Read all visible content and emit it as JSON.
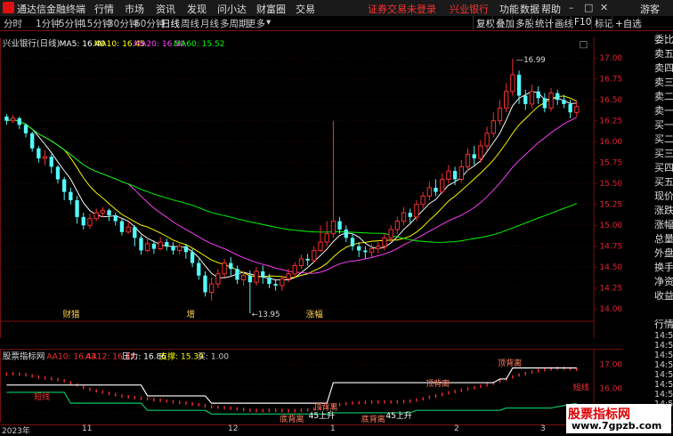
{
  "app": {
    "title": "通达信金融终端",
    "menu": [
      "行情",
      "市场",
      "资讯",
      "发现",
      "问小达",
      "财富圈",
      "交易"
    ],
    "login_notice": "证券交易未登录",
    "stock_name_title": "兴业银行",
    "right_menu": [
      "功能",
      "数据",
      "帮助"
    ],
    "user": "游客"
  },
  "toolbar": {
    "periods": [
      "分时",
      "1分钟",
      "5分钟",
      "15分钟",
      "30分钟",
      "60分钟",
      "日线",
      "周线",
      "月线",
      "多周期",
      "更多"
    ],
    "active_period": "日线",
    "right_buttons": [
      "复权",
      "叠加",
      "多股",
      "统计",
      "画线",
      "F10",
      "标记",
      "+自选"
    ]
  },
  "main_chart": {
    "label": "兴业银行(日线)",
    "ma_labels": [
      {
        "text": "MA5: 16.40",
        "color": "#ffffff"
      },
      {
        "text": "MA10: 16.45",
        "color": "#ffff00"
      },
      {
        "text": "MA20: 16.50",
        "color": "#ff40ff"
      },
      {
        "text": "MA60: 15.52",
        "color": "#00ff00"
      }
    ],
    "high_annot": "16.99",
    "low_annot": "←13.95",
    "markers": [
      "财猎",
      "增",
      "涨幅"
    ]
  },
  "indicator": {
    "name": "股票指标网",
    "values": [
      {
        "text": "AA10: 16.43",
        "color": "#ff3030"
      },
      {
        "text": "AA12: 16.48",
        "color": "#ff3030"
      },
      {
        "text": "压力: 16.86",
        "color": "#ffffff"
      },
      {
        "text": "支撑: 15.39",
        "color": "#ffff00"
      },
      {
        "text": "买: 1.00",
        "color": "#cccccc"
      }
    ],
    "annotations": [
      "顶背离",
      "顶背离",
      "顶背离",
      "短线",
      "短线",
      "45上升",
      "45上升",
      "底背离",
      "底背离"
    ]
  },
  "side_panel": {
    "labels": [
      "委比",
      "卖五",
      "卖四",
      "卖三",
      "卖二",
      "卖一",
      "买一",
      "买二",
      "买三",
      "买四",
      "买五",
      "现价",
      "涨跌",
      "涨幅",
      "总量",
      "外盘",
      "换手",
      "净资",
      "收益",
      "",
      "行情"
    ],
    "times": [
      "14:50",
      "14:50",
      "14:50",
      "14:50",
      "14:50",
      "14:50",
      "14:50",
      "14:50"
    ]
  },
  "bottom": {
    "dates": [
      "2023年",
      "11",
      "12",
      "1",
      "2",
      "3"
    ]
  },
  "watermark": {
    "line1": "股票指标网",
    "line2": "www.7gpzb.com"
  },
  "chart_data": [
    {
      "type": "candlestick",
      "title": "兴业银行(日线)",
      "y_ticks": [
        14.0,
        14.25,
        14.5,
        14.75,
        15.0,
        15.25,
        15.5,
        15.75,
        16.0,
        16.25,
        16.5,
        16.75,
        17.0
      ],
      "ylim": [
        13.9,
        17.1
      ],
      "annotations": [
        {
          "text": "16.99",
          "value": 16.99
        },
        {
          "text": "←13.95",
          "value": 13.95
        }
      ],
      "candles": [
        [
          16.3,
          16.25,
          16.33,
          16.2
        ],
        [
          16.25,
          16.28,
          16.32,
          16.22
        ],
        [
          16.28,
          16.2,
          16.3,
          16.15
        ],
        [
          16.2,
          16.1,
          16.22,
          16.05
        ],
        [
          16.1,
          15.92,
          16.12,
          15.88
        ],
        [
          15.92,
          15.8,
          15.95,
          15.75
        ],
        [
          15.8,
          15.82,
          15.9,
          15.72
        ],
        [
          15.82,
          15.7,
          15.85,
          15.62
        ],
        [
          15.7,
          15.55,
          15.72,
          15.5
        ],
        [
          15.55,
          15.4,
          15.58,
          15.3
        ],
        [
          15.4,
          15.3,
          15.45,
          15.25
        ],
        [
          15.3,
          15.1,
          15.35,
          15.02
        ],
        [
          15.1,
          15.0,
          15.15,
          14.95
        ],
        [
          15.0,
          15.08,
          15.14,
          14.96
        ],
        [
          15.08,
          15.15,
          15.2,
          15.05
        ],
        [
          15.15,
          15.18,
          15.22,
          15.1
        ],
        [
          15.18,
          15.12,
          15.2,
          15.05
        ],
        [
          15.12,
          15.05,
          15.15,
          15.0
        ],
        [
          15.05,
          14.92,
          15.08,
          14.88
        ],
        [
          14.92,
          14.98,
          15.05,
          14.9
        ],
        [
          14.98,
          14.85,
          15.0,
          14.75
        ],
        [
          14.85,
          14.7,
          14.88,
          14.65
        ],
        [
          14.7,
          14.78,
          14.85,
          14.68
        ],
        [
          14.78,
          14.72,
          14.82,
          14.66
        ],
        [
          14.72,
          14.8,
          14.86,
          14.7
        ],
        [
          14.8,
          14.75,
          14.84,
          14.7
        ],
        [
          14.75,
          14.7,
          14.8,
          14.65
        ],
        [
          14.7,
          14.75,
          14.8,
          14.65
        ],
        [
          14.75,
          14.68,
          14.78,
          14.6
        ],
        [
          14.68,
          14.55,
          14.72,
          14.5
        ],
        [
          14.55,
          14.4,
          14.6,
          14.35
        ],
        [
          14.4,
          14.2,
          14.45,
          14.15
        ],
        [
          14.2,
          14.3,
          14.38,
          14.1
        ],
        [
          14.3,
          14.42,
          14.48,
          14.25
        ],
        [
          14.42,
          14.55,
          14.6,
          14.38
        ],
        [
          14.55,
          14.48,
          14.62,
          14.4
        ],
        [
          14.48,
          14.35,
          14.52,
          14.3
        ],
        [
          14.35,
          14.4,
          14.45,
          14.28
        ],
        [
          14.4,
          14.32,
          14.46,
          13.95
        ],
        [
          14.32,
          14.45,
          14.5,
          14.28
        ],
        [
          14.45,
          14.38,
          14.52,
          14.3
        ],
        [
          14.38,
          14.3,
          14.42,
          14.25
        ],
        [
          14.3,
          14.28,
          14.36,
          14.22
        ],
        [
          14.28,
          14.36,
          14.4,
          14.22
        ],
        [
          14.36,
          14.42,
          14.48,
          14.32
        ],
        [
          14.42,
          14.52,
          14.56,
          14.38
        ],
        [
          14.52,
          14.6,
          14.65,
          14.48
        ],
        [
          14.6,
          14.58,
          14.66,
          14.52
        ],
        [
          14.58,
          14.7,
          14.75,
          14.55
        ],
        [
          14.7,
          14.8,
          15.0,
          14.68
        ],
        [
          14.8,
          14.9,
          15.05,
          14.75
        ],
        [
          14.9,
          15.05,
          16.25,
          14.85
        ],
        [
          15.05,
          14.95,
          15.1,
          14.9
        ],
        [
          14.95,
          14.85,
          15.0,
          14.8
        ],
        [
          14.85,
          14.75,
          14.9,
          14.7
        ],
        [
          14.75,
          14.7,
          14.8,
          14.62
        ],
        [
          14.7,
          14.68,
          14.75,
          14.6
        ],
        [
          14.68,
          14.72,
          14.78,
          14.62
        ],
        [
          14.72,
          14.75,
          14.8,
          14.66
        ],
        [
          14.75,
          14.85,
          14.9,
          14.7
        ],
        [
          14.85,
          14.95,
          15.0,
          14.8
        ],
        [
          14.95,
          15.05,
          15.1,
          14.9
        ],
        [
          15.05,
          15.15,
          15.22,
          15.0
        ],
        [
          15.15,
          15.1,
          15.2,
          15.02
        ],
        [
          15.1,
          15.25,
          15.3,
          15.05
        ],
        [
          15.25,
          15.35,
          15.4,
          15.2
        ],
        [
          15.35,
          15.45,
          15.52,
          15.3
        ],
        [
          15.45,
          15.4,
          15.55,
          15.35
        ],
        [
          15.4,
          15.55,
          15.62,
          15.38
        ],
        [
          15.55,
          15.65,
          15.72,
          15.5
        ],
        [
          15.65,
          15.55,
          15.7,
          15.48
        ],
        [
          15.55,
          15.7,
          15.78,
          15.52
        ],
        [
          15.7,
          15.85,
          15.92,
          15.65
        ],
        [
          15.85,
          15.8,
          15.95,
          15.72
        ],
        [
          15.8,
          15.95,
          16.02,
          15.75
        ],
        [
          15.95,
          16.1,
          16.18,
          15.9
        ],
        [
          16.1,
          16.25,
          16.35,
          16.05
        ],
        [
          16.25,
          16.4,
          16.5,
          16.2
        ],
        [
          16.4,
          16.6,
          16.7,
          16.35
        ],
        [
          16.6,
          16.8,
          16.99,
          16.55
        ],
        [
          16.8,
          16.55,
          16.85,
          16.45
        ],
        [
          16.55,
          16.45,
          16.62,
          16.38
        ],
        [
          16.45,
          16.6,
          16.68,
          16.4
        ],
        [
          16.6,
          16.52,
          16.66,
          16.45
        ],
        [
          16.52,
          16.4,
          16.58,
          16.35
        ],
        [
          16.4,
          16.58,
          16.64,
          16.36
        ],
        [
          16.58,
          16.5,
          16.62,
          16.44
        ],
        [
          16.5,
          16.45,
          16.56,
          16.4
        ],
        [
          16.45,
          16.35,
          16.5,
          16.28
        ],
        [
          16.35,
          16.42,
          16.48,
          16.3
        ]
      ],
      "ma": {
        "MA5": {
          "color": "#ffffff"
        },
        "MA10": {
          "color": "#ffff00"
        },
        "MA20": {
          "color": "#ff40ff"
        },
        "MA60": {
          "color": "#00ff00"
        }
      }
    },
    {
      "type": "line",
      "title": "股票指标网",
      "y_ticks": [
        15.0,
        16.0,
        17.0
      ],
      "ylim": [
        14.7,
        17.3
      ],
      "series": [
        {
          "name": "压力",
          "color": "#ffffff",
          "values": [
            16.15,
            16.15,
            16.15,
            16.15,
            16.15,
            16.15,
            16.15,
            16.15,
            16.15,
            16.15,
            16.15,
            16.15,
            16.15,
            16.15,
            16.15,
            16.15,
            16.15,
            16.15,
            16.15,
            16.15,
            16.15,
            16.15,
            15.7,
            15.7,
            15.7,
            15.7,
            15.7,
            15.7,
            15.7,
            15.7,
            15.7,
            15.7,
            15.4,
            15.4,
            15.4,
            15.4,
            15.4,
            15.4,
            15.4,
            15.4,
            15.4,
            15.4,
            15.4,
            15.4,
            15.4,
            15.4,
            15.4,
            15.4,
            15.4,
            15.4,
            15.4,
            16.25,
            16.25,
            16.25,
            16.25,
            16.25,
            16.25,
            16.25,
            16.25,
            16.25,
            16.25,
            16.25,
            16.25,
            16.25,
            16.25,
            16.25,
            16.25,
            16.25,
            16.25,
            16.25,
            16.25,
            16.25,
            16.25,
            16.25,
            16.25,
            16.25,
            16.25,
            16.4,
            16.4,
            16.86,
            16.86,
            16.86,
            16.86,
            16.86,
            16.86,
            16.86,
            16.86,
            16.86,
            16.86,
            16.86
          ]
        },
        {
          "name": "支撑",
          "color": "#00cc66",
          "values": [
            15.85,
            15.85,
            15.85,
            15.85,
            15.85,
            15.85,
            15.85,
            15.85,
            15.85,
            15.85,
            15.4,
            15.4,
            15.4,
            15.4,
            15.4,
            15.4,
            15.4,
            15.4,
            15.4,
            15.4,
            15.4,
            15.4,
            15.1,
            15.1,
            15.1,
            15.1,
            15.1,
            15.1,
            15.1,
            15.1,
            15.1,
            15.1,
            14.95,
            14.95,
            14.95,
            14.95,
            14.95,
            14.95,
            14.95,
            14.95,
            14.95,
            14.95,
            14.95,
            14.95,
            14.95,
            14.95,
            14.95,
            14.95,
            14.95,
            14.95,
            14.95,
            15.0,
            15.0,
            15.0,
            15.0,
            15.0,
            15.0,
            15.0,
            15.0,
            15.0,
            15.0,
            15.0,
            15.0,
            15.0,
            15.1,
            15.1,
            15.1,
            15.1,
            15.1,
            15.1,
            15.1,
            15.1,
            15.1,
            15.1,
            15.1,
            15.1,
            15.1,
            15.1,
            15.2,
            15.2,
            15.2,
            15.2,
            15.2,
            15.2,
            15.2,
            15.2,
            15.25,
            15.3,
            15.35,
            15.39
          ]
        }
      ]
    }
  ]
}
